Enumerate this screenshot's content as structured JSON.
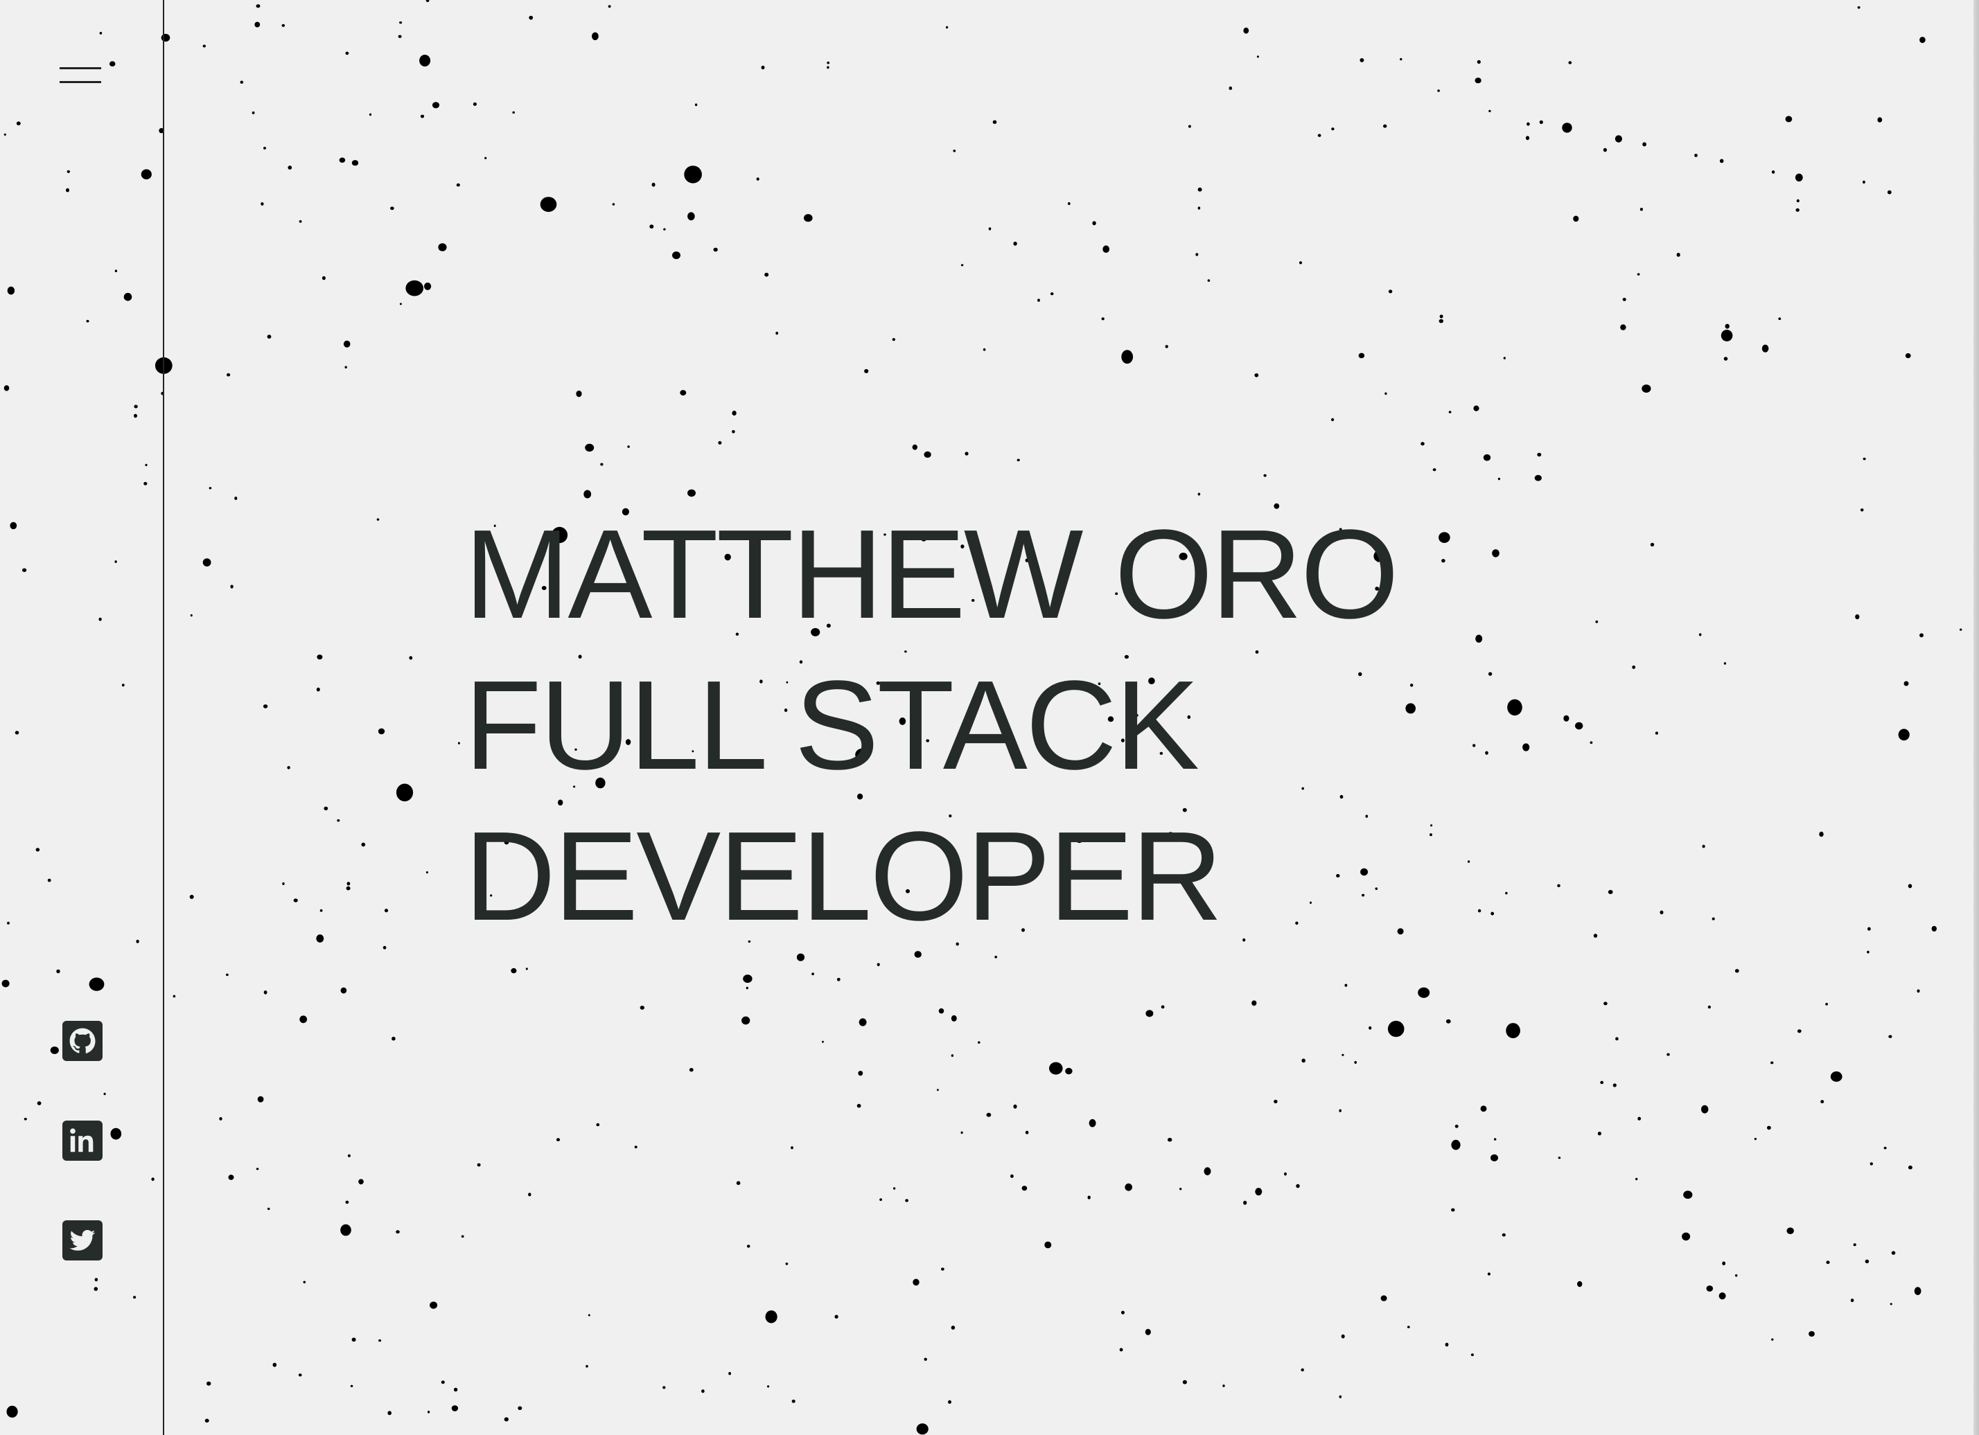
{
  "sidebar": {
    "menu_icon": "hamburger-icon",
    "social": [
      {
        "name": "github",
        "icon": "github-icon"
      },
      {
        "name": "linkedin",
        "icon": "linkedin-icon"
      },
      {
        "name": "twitter",
        "icon": "twitter-icon"
      }
    ]
  },
  "hero": {
    "name": "MATTHEW ORO",
    "title_line1": "FULL STACK",
    "title_line2": "DEVELOPER"
  },
  "colors": {
    "background": "#f0f0f0",
    "text": "#252b29",
    "star": "#000000",
    "icon_bg": "#262c2a"
  }
}
